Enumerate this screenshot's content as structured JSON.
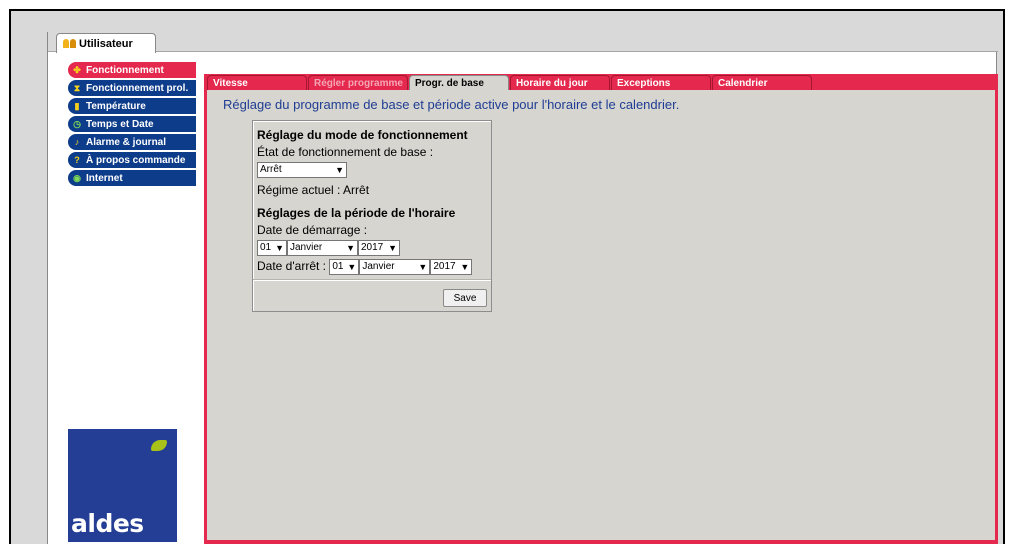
{
  "user_tab": {
    "label": "Utilisateur"
  },
  "sidebar": {
    "items": [
      {
        "label": "Fonctionnement",
        "icon": "fan-icon",
        "active": true
      },
      {
        "label": "Fonctionnement prol.",
        "icon": "hourglass-icon"
      },
      {
        "label": "Température",
        "icon": "thermometer-icon"
      },
      {
        "label": "Temps et Date",
        "icon": "clock-icon"
      },
      {
        "label": "Alarme & journal",
        "icon": "bell-icon"
      },
      {
        "label": "À propos commande",
        "icon": "question-icon"
      },
      {
        "label": "Internet",
        "icon": "globe-icon"
      }
    ]
  },
  "tabs": [
    {
      "label": "Vitesse"
    },
    {
      "label": "Régler programme",
      "disabled": true
    },
    {
      "label": "Progr. de base",
      "active": true
    },
    {
      "label": "Horaire du jour"
    },
    {
      "label": "Exceptions"
    },
    {
      "label": "Calendrier"
    }
  ],
  "main": {
    "heading": "Réglage du programme de base et période active pour l'horaire et le calendrier.",
    "mode_title": "Réglage du mode de fonctionnement",
    "base_state_label": "État de fonctionnement de base :",
    "base_state_value": "Arrêt",
    "current_regime": "Régime actuel : Arrêt",
    "period_title": "Réglages de la période de l'horaire",
    "start_label": "Date de démarrage :",
    "start_day": "01",
    "start_month": "Janvier",
    "start_year": "2017",
    "stop_label": "Date d'arrêt :",
    "stop_day": "01",
    "stop_month": "Janvier",
    "stop_year": "2017",
    "save_label": "Save"
  },
  "logo": {
    "text": "aldes"
  },
  "colors": {
    "accent": "#e5284d",
    "nav": "#0d3c8a",
    "panel": "#d6d5cf",
    "heading": "#1f3d94",
    "logo_bg": "#233e94",
    "leaf": "#a8c21a"
  }
}
